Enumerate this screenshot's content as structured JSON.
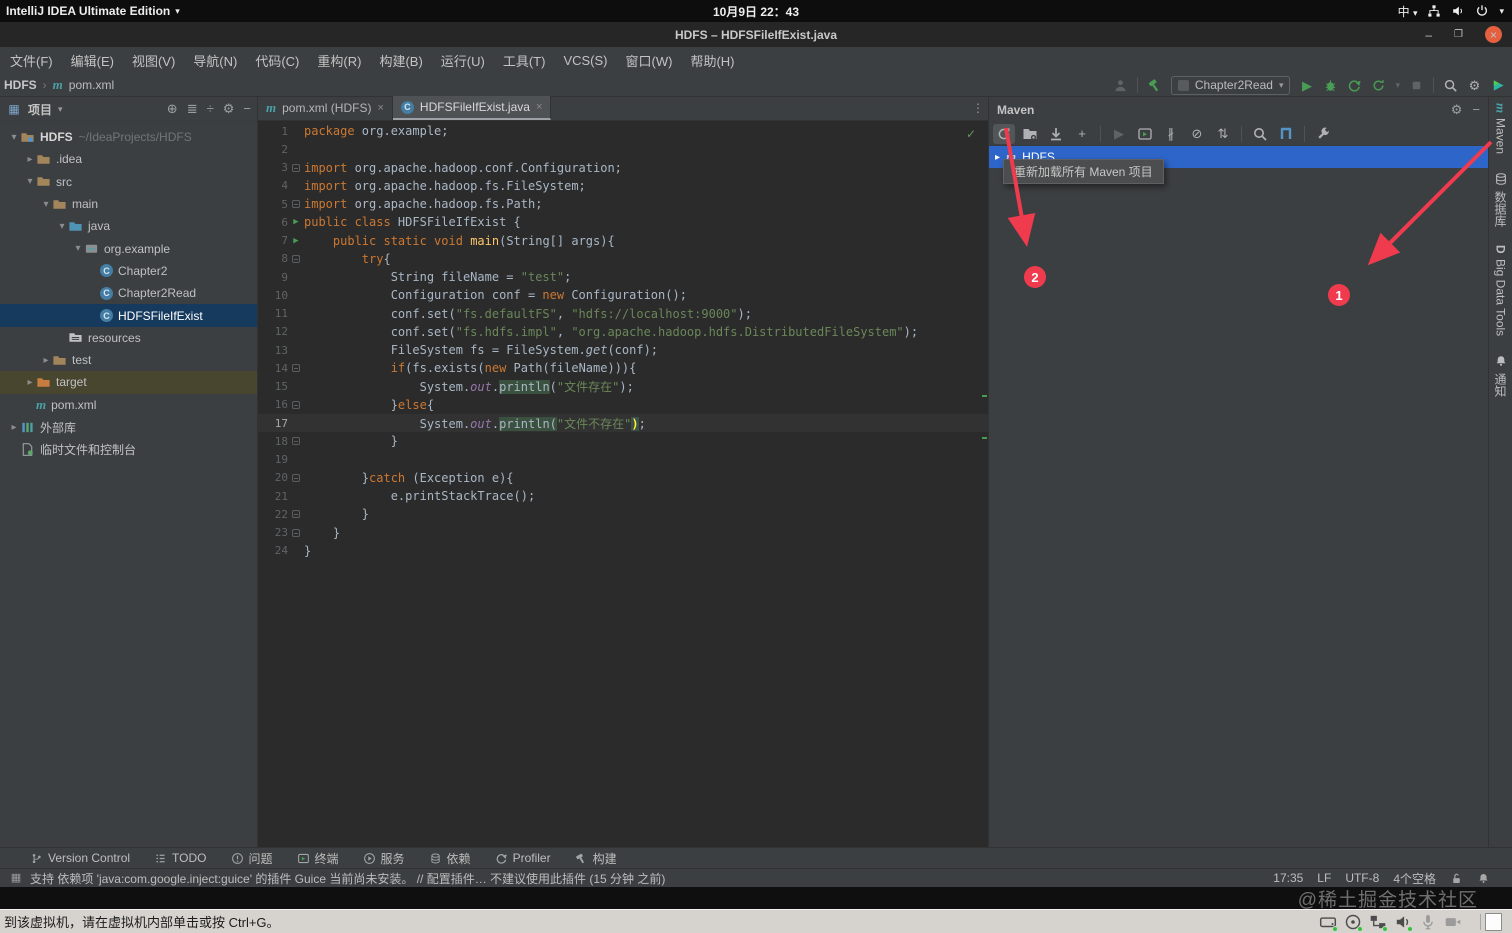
{
  "os_bar": {
    "app": "IntelliJ IDEA Ultimate Edition",
    "clock": "10月9日 22：43",
    "ime": "中"
  },
  "title_bar": {
    "title": "HDFS – HDFSFileIfExist.java"
  },
  "menu": {
    "items": [
      "文件(F)",
      "编辑(E)",
      "视图(V)",
      "导航(N)",
      "代码(C)",
      "重构(R)",
      "构建(B)",
      "运行(U)",
      "工具(T)",
      "VCS(S)",
      "窗口(W)",
      "帮助(H)"
    ]
  },
  "navbar": {
    "breadcrumbs": [
      "HDFS",
      "pom.xml"
    ],
    "run_config": "Chapter2Read"
  },
  "project": {
    "header": "项目",
    "tree": [
      {
        "label": "HDFS",
        "sub": "~/IdeaProjects/HDFS",
        "icon": "project",
        "chev": "v",
        "ind": 0,
        "bold": true
      },
      {
        "label": ".idea",
        "icon": "folder",
        "chev": ">",
        "ind": 1
      },
      {
        "label": "src",
        "icon": "folder",
        "chev": "v",
        "ind": 1
      },
      {
        "label": "main",
        "icon": "folder",
        "chev": "v",
        "ind": 2
      },
      {
        "label": "java",
        "icon": "folder-src",
        "chev": "v",
        "ind": 3
      },
      {
        "label": "org.example",
        "icon": "package",
        "chev": "v",
        "ind": 4
      },
      {
        "label": "Chapter2",
        "icon": "class",
        "chev": "",
        "ind": 5
      },
      {
        "label": "Chapter2Read",
        "icon": "class",
        "chev": "",
        "ind": 5
      },
      {
        "label": "HDFSFileIfExist",
        "icon": "class",
        "chev": "",
        "ind": 5,
        "state": "selected"
      },
      {
        "label": "resources",
        "icon": "resources",
        "chev": "",
        "ind": 3
      },
      {
        "label": "test",
        "icon": "folder",
        "chev": ">",
        "ind": 2
      },
      {
        "label": "target",
        "icon": "folder-excluded",
        "chev": ">",
        "ind": 1,
        "state": "excluded"
      },
      {
        "label": "pom.xml",
        "icon": "maven",
        "chev": "",
        "ind": 1
      },
      {
        "label": "外部库",
        "icon": "libraries",
        "chev": ">",
        "ind": 0
      },
      {
        "label": "临时文件和控制台",
        "icon": "scratches",
        "chev": "",
        "ind": 0
      }
    ]
  },
  "editor": {
    "tabs": [
      {
        "label": "pom.xml (HDFS)",
        "icon": "maven",
        "active": false
      },
      {
        "label": "HDFSFileIfExist.java",
        "icon": "class",
        "active": true
      }
    ],
    "lines": [
      {
        "n": 1,
        "t": [
          [
            "kw",
            "package "
          ],
          [
            "pln",
            "org.example;"
          ]
        ]
      },
      {
        "n": 2,
        "t": []
      },
      {
        "n": 3,
        "fold": true,
        "t": [
          [
            "kw",
            "import "
          ],
          [
            "pln",
            "org.apache.hadoop.conf.Configuration;"
          ]
        ]
      },
      {
        "n": 4,
        "t": [
          [
            "kw",
            "import "
          ],
          [
            "pln",
            "org.apache.hadoop.fs.FileSystem;"
          ]
        ]
      },
      {
        "n": 5,
        "fold": true,
        "t": [
          [
            "kw",
            "import "
          ],
          [
            "pln",
            "org.apache.hadoop.fs.Path;"
          ]
        ]
      },
      {
        "n": 6,
        "run": true,
        "t": [
          [
            "kw",
            "public class "
          ],
          [
            "pln",
            "HDFSFileIfExist {"
          ]
        ]
      },
      {
        "n": 7,
        "run": true,
        "fold": true,
        "t": [
          [
            "pln",
            "    "
          ],
          [
            "kw",
            "public static void "
          ],
          [
            "mtd",
            "main"
          ],
          [
            "pln",
            "(String[] args){"
          ]
        ]
      },
      {
        "n": 8,
        "fold": true,
        "t": [
          [
            "pln",
            "        "
          ],
          [
            "kw",
            "try"
          ],
          [
            "pln",
            "{"
          ]
        ]
      },
      {
        "n": 9,
        "t": [
          [
            "pln",
            "            String fileName = "
          ],
          [
            "str",
            "\"test\""
          ],
          [
            "pln",
            ";"
          ]
        ]
      },
      {
        "n": 10,
        "t": [
          [
            "pln",
            "            Configuration conf = "
          ],
          [
            "kw",
            "new "
          ],
          [
            "pln",
            "Configuration();"
          ]
        ]
      },
      {
        "n": 11,
        "t": [
          [
            "pln",
            "            conf.set("
          ],
          [
            "str",
            "\"fs.defaultFS\""
          ],
          [
            "pln",
            ", "
          ],
          [
            "str",
            "\"hdfs://localhost:9000\""
          ],
          [
            "pln",
            ");"
          ]
        ]
      },
      {
        "n": 12,
        "t": [
          [
            "pln",
            "            conf.set("
          ],
          [
            "str",
            "\"fs.hdfs.impl\""
          ],
          [
            "pln",
            ", "
          ],
          [
            "str",
            "\"org.apache.hadoop.hdfs.DistributedFileSystem\""
          ],
          [
            "pln",
            ");"
          ]
        ]
      },
      {
        "n": 13,
        "t": [
          [
            "pln",
            "            FileSystem fs = FileSystem."
          ],
          [
            "sm",
            "get"
          ],
          [
            "pln",
            "(conf);"
          ]
        ]
      },
      {
        "n": 14,
        "fold": true,
        "t": [
          [
            "pln",
            "            "
          ],
          [
            "kw",
            "if"
          ],
          [
            "pln",
            "(fs.exists("
          ],
          [
            "kw",
            "new "
          ],
          [
            "pln",
            "Path(fileName))){"
          ]
        ]
      },
      {
        "n": 15,
        "t": [
          [
            "pln",
            "                System."
          ],
          [
            "sf",
            "out"
          ],
          [
            "pln",
            "."
          ],
          [
            "hl",
            "println"
          ],
          [
            "pln",
            "("
          ],
          [
            "str",
            "\"文件存在\""
          ],
          [
            "pln",
            ");"
          ]
        ]
      },
      {
        "n": 16,
        "fold": true,
        "t": [
          [
            "pln",
            "            }"
          ],
          [
            "kw",
            "else"
          ],
          [
            "pln",
            "{"
          ]
        ]
      },
      {
        "n": 17,
        "cur": true,
        "t": [
          [
            "pln",
            "                System."
          ],
          [
            "sf",
            "out"
          ],
          [
            "pln",
            "."
          ],
          [
            "hl",
            "println"
          ],
          [
            "hlb",
            "("
          ],
          [
            "str",
            "\"文件不存在\""
          ],
          [
            "match",
            ")"
          ],
          [
            "pln",
            ";"
          ]
        ]
      },
      {
        "n": 18,
        "fold": true,
        "t": [
          [
            "pln",
            "            }"
          ]
        ]
      },
      {
        "n": 19,
        "t": []
      },
      {
        "n": 20,
        "fold": true,
        "t": [
          [
            "pln",
            "        }"
          ],
          [
            "kw",
            "catch"
          ],
          [
            "pln",
            " (Exception e){"
          ]
        ]
      },
      {
        "n": 21,
        "t": [
          [
            "pln",
            "            e.printStackTrace();"
          ]
        ]
      },
      {
        "n": 22,
        "fold": true,
        "t": [
          [
            "pln",
            "        }"
          ]
        ]
      },
      {
        "n": 23,
        "fold": true,
        "t": [
          [
            "pln",
            "    }"
          ]
        ]
      },
      {
        "n": 24,
        "t": [
          [
            "pln",
            "}"
          ]
        ]
      }
    ]
  },
  "maven": {
    "title": "Maven",
    "project_row": "HDFS",
    "tooltip": "重新加载所有 Maven 项目",
    "callouts": [
      {
        "label": "1"
      },
      {
        "label": "2"
      }
    ],
    "toolbar": [
      {
        "name": "reload-all-maven-projects-icon",
        "icon": "reload",
        "hover": true
      },
      {
        "name": "generate-sources-icon",
        "icon": "foldergear"
      },
      {
        "name": "download-sources-icon",
        "icon": "download"
      },
      {
        "name": "add-maven-project-icon",
        "icon": "t:+"
      },
      {
        "sep": true
      },
      {
        "name": "run-maven-build-icon",
        "icon": "t:▶",
        "dim": true
      },
      {
        "name": "execute-maven-goal-icon",
        "icon": "terminal"
      },
      {
        "name": "toggle-skip-tests-icon",
        "icon": "t:∦"
      },
      {
        "name": "toggle-offline-mode-icon",
        "icon": "t:⊘"
      },
      {
        "name": "collapse-all-icon",
        "icon": "t:⇅"
      },
      {
        "sep": true
      },
      {
        "name": "analyze-dependencies-icon",
        "icon": "search"
      },
      {
        "name": "dependency-diagram-icon",
        "icon": "diagram"
      },
      {
        "sep": true
      },
      {
        "name": "maven-settings-icon",
        "icon": "wrench"
      }
    ]
  },
  "right_stripe": {
    "items": [
      {
        "label": "Maven",
        "icon": "maven"
      },
      {
        "label": "数据库",
        "icon": "db"
      },
      {
        "label": "Big Data Tools",
        "icon": "bigdata"
      },
      {
        "label": "通知",
        "icon": "bell"
      }
    ]
  },
  "bottom_tools": {
    "items": [
      {
        "label": "Version Control",
        "icon": "branch"
      },
      {
        "label": "TODO",
        "icon": "list"
      },
      {
        "label": "问题",
        "icon": "alert"
      },
      {
        "label": "终端",
        "icon": "terminal"
      },
      {
        "label": "服务",
        "icon": "playcircle"
      },
      {
        "label": "依赖",
        "icon": "coins"
      },
      {
        "label": "Profiler",
        "icon": "gauge"
      },
      {
        "label": "构建",
        "icon": "hammer"
      }
    ]
  },
  "status_bar": {
    "message": "支持 依赖项 'java:com.google.inject:guice' 的插件 Guice 当前尚未安装。 // 配置插件…  不建议使用此插件 (15 分钟 之前)",
    "time": "17:35",
    "line_sep": "LF",
    "encoding": "UTF-8",
    "indent": "4个空格"
  },
  "watermark": "@稀土掘金技术社区",
  "vm_bar": {
    "message": "到该虚拟机，请在虚拟机内部单击或按 Ctrl+G。",
    "devices": [
      {
        "name": "vm-disk-icon",
        "icon": "hdd",
        "on": true
      },
      {
        "name": "vm-cd-icon",
        "icon": "cd",
        "on": true
      },
      {
        "name": "vm-network-icon",
        "icon": "vmnet",
        "on": true
      },
      {
        "name": "vm-sound-icon",
        "icon": "speaker",
        "on": true
      },
      {
        "name": "vm-mic-icon",
        "icon": "mic",
        "on": false
      },
      {
        "name": "vm-camera-icon",
        "icon": "camera",
        "on": false
      }
    ]
  },
  "colors": {
    "selection_blue": "#2e65c9",
    "tree_selection": "#163a5e",
    "annotation_red": "#ef3b4d",
    "run_green": "#499c54",
    "editor_bg": "#2b2b2b",
    "panel_bg": "#3c3f41",
    "keyword": "#cc7832",
    "string": "#6a8759",
    "excluded_row": "#49462f",
    "close_button": "#e4603f"
  }
}
